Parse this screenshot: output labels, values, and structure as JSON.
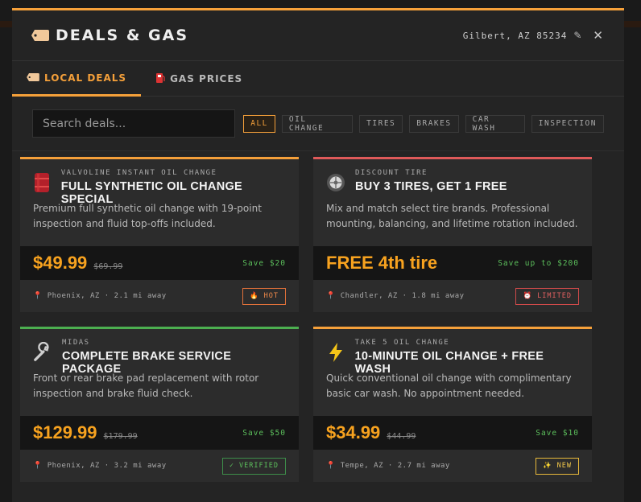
{
  "header": {
    "title": "DEALS & GAS",
    "location": "Gilbert, AZ 85234",
    "edit_icon": "pencil-icon",
    "close_icon": "close-icon"
  },
  "tabs": [
    {
      "label": "LOCAL DEALS",
      "icon": "tag-icon",
      "active": true
    },
    {
      "label": "GAS PRICES",
      "icon": "fuel-pump-icon",
      "active": false
    }
  ],
  "search": {
    "placeholder": "Search deals...",
    "value": ""
  },
  "filters": [
    "ALL",
    "OIL CHANGE",
    "TIRES",
    "BRAKES",
    "CAR WASH",
    "INSPECTION"
  ],
  "active_filter": "ALL",
  "deals": [
    {
      "vendor": "VALVOLINE INSTANT OIL CHANGE",
      "title": "FULL SYNTHETIC OIL CHANGE SPECIAL",
      "description": "Premium full synthetic oil change with 19-point inspection and fluid top-offs included.",
      "price": "$49.99",
      "old_price": "$69.99",
      "save": "Save $20",
      "location": "Phoenix, AZ · 2.1 mi away",
      "badge": "🔥 HOT",
      "icon": "oil-barrel-icon",
      "accent": "#f5a03a"
    },
    {
      "vendor": "DISCOUNT TIRE",
      "title": "BUY 3 TIRES, GET 1 FREE",
      "description": "Mix and match select tire brands. Professional mounting, balancing, and lifetime rotation included.",
      "price": "FREE 4th tire",
      "old_price": "",
      "save": "Save up to $200",
      "location": "Chandler, AZ · 1.8 mi away",
      "badge": "⏰ LIMITED",
      "icon": "tire-icon",
      "accent": "#e05a5a"
    },
    {
      "vendor": "MIDAS",
      "title": "COMPLETE BRAKE SERVICE PACKAGE",
      "description": "Front or rear brake pad replacement with rotor inspection and brake fluid check.",
      "price": "$129.99",
      "old_price": "$179.99",
      "save": "Save $50",
      "location": "Phoenix, AZ · 3.2 mi away",
      "badge": "✓ VERIFIED",
      "icon": "wrench-icon",
      "accent": "#4caf50"
    },
    {
      "vendor": "TAKE 5 OIL CHANGE",
      "title": "10-MINUTE OIL CHANGE + FREE WASH",
      "description": "Quick conventional oil change with complimentary basic car wash. No appointment needed.",
      "price": "$34.99",
      "old_price": "$44.99",
      "save": "Save $10",
      "location": "Tempe, AZ · 2.7 mi away",
      "badge": "✨ NEW",
      "icon": "lightning-icon",
      "accent": "#f5a03a"
    }
  ]
}
